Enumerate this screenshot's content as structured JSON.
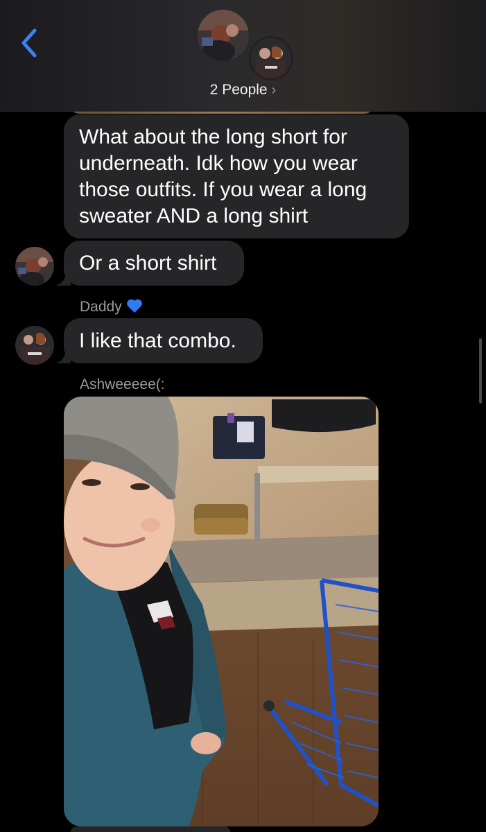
{
  "header": {
    "back_icon": "chevron-left-icon",
    "group_label": "2 People",
    "group_chevron": "›",
    "accent_color": "#3b82f6"
  },
  "messages": [
    {
      "text": "What about the long short for underneath. Idk how you wear those outfits. If you wear a long sweater AND a long shirt"
    },
    {
      "text": "Or a short shirt"
    },
    {
      "sender": "Daddy",
      "sender_emoji": "blue-heart-icon",
      "text": "I like that combo."
    },
    {
      "sender": "Ashweeeee(:",
      "attachment": "photo"
    }
  ],
  "colors": {
    "bubble": "#262628",
    "sender_name": "#9b9b9b",
    "heart": "#2f7bf5"
  }
}
